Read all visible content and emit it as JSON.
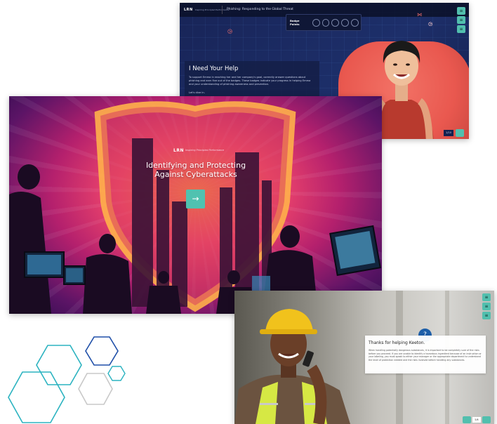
{
  "top_screen": {
    "logo": "LRN",
    "logo_sub": "Inspiring Principled Performance",
    "course_title": "Phishing: Responding to the Global Threat",
    "badge_label": "Badge Points",
    "badge_count": 5,
    "card_title": "I Need Your Help",
    "card_body": "To support Emma in reaching her and her company's goal, correctly answer questions about phishing and earn five out of the badges. These badges indicate your progress in helping Emma and your understanding of phishing awareness and prevention.",
    "card_start": "Let's dive in.",
    "page_counter": "1/10",
    "side_buttons": [
      "≡",
      "≡",
      "≡"
    ]
  },
  "main_screen": {
    "logo": "LRN",
    "logo_sub": "Inspiring Principled Performance",
    "title_line1": "Identifying and Protecting",
    "title_line2": "Against Cyberattacks",
    "start_icon": "→"
  },
  "bottom_screen": {
    "help_icon": "?",
    "card_title": "Thanks for helping Keeton.",
    "card_body": "When handling potentially dangerous substances, it is important to be completely sure of the risks before you proceed. If you are unable to identify a hazardous ingredient because of an instruction or your labeling, you must speak to either your manager or the appropriate department to understand the level of protection needed and the risks involved before handling any substances.",
    "page_counter": "5/6",
    "side_buttons": [
      "≡",
      "≡",
      "≡"
    ]
  },
  "colors": {
    "teal_accent": "#52bfae",
    "navy": "#1b2a5c",
    "hex_blue": "#1f4fa8",
    "hex_cyan": "#2bb3c0",
    "hex_gray": "#c8c8c8"
  }
}
